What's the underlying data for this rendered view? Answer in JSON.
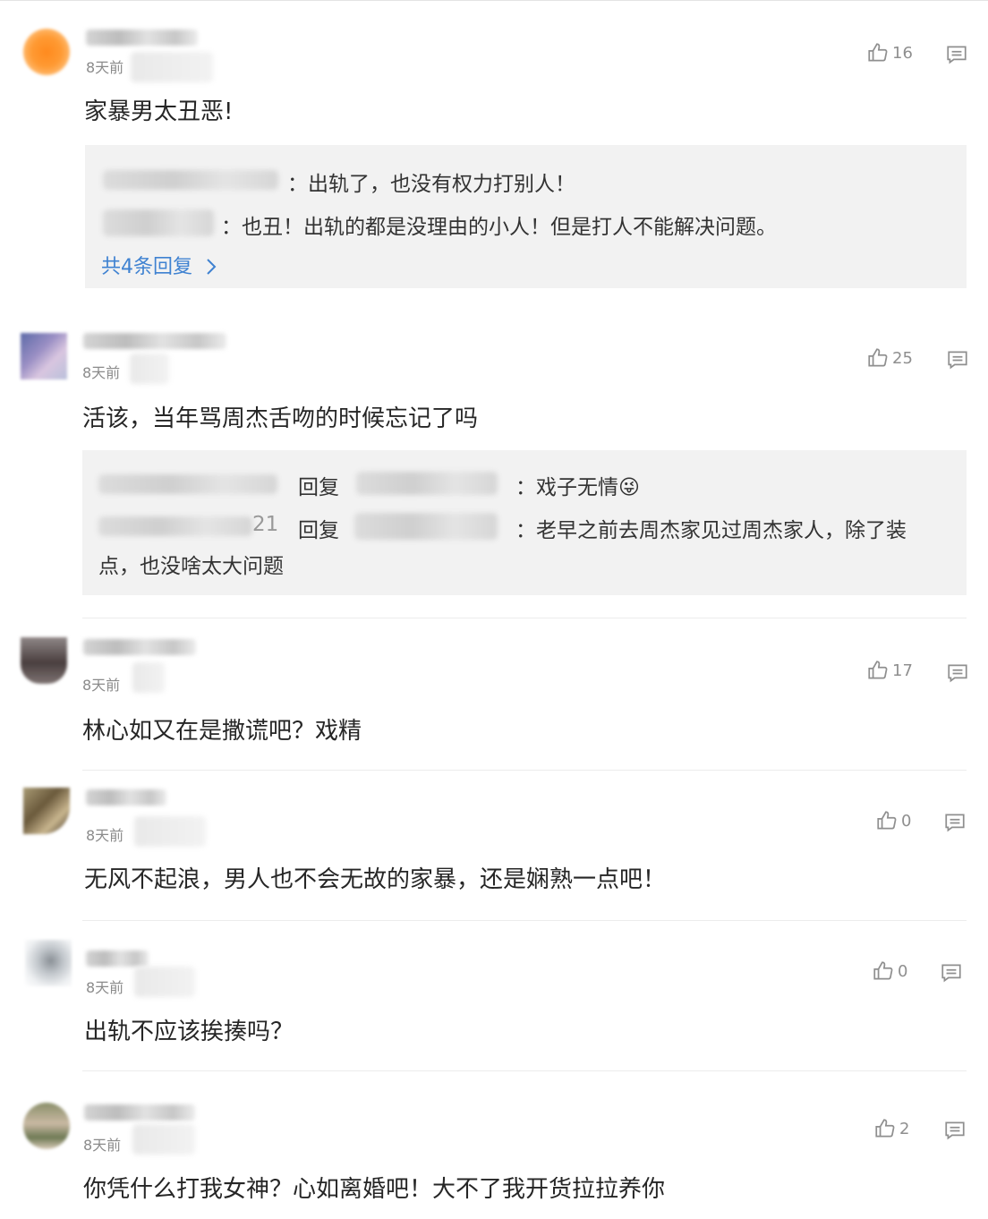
{
  "comments": [
    {
      "time": "8天前",
      "text": "家暴男太丑恶!",
      "likes": "16",
      "avatar_colors": [
        "#ff8a1e",
        "#ffb25c"
      ],
      "replies": [
        {
          "text": "：出轨了，也没有权力打别人！"
        },
        {
          "text": "：也丑！出轨的都是没理由的小人！但是打人不能解决问题。"
        }
      ],
      "more_replies": "共4条回复"
    },
    {
      "time": "8天前",
      "text": "活该，当年骂周杰舌吻的时候忘记了吗",
      "likes": "25",
      "avatar_colors": [
        "#6e72a6",
        "#c9c3de"
      ],
      "replies": [
        {
          "reply_word": "回复",
          "text": "：戏子无情😜"
        },
        {
          "partial": "21",
          "reply_word": "回复",
          "text": "：老早之前去周杰家见过周杰家人，除了装",
          "text_wrap": "点，也没啥太大问题"
        }
      ]
    },
    {
      "time": "8天前",
      "text": "林心如又在是撒谎吧？戏精",
      "likes": "17",
      "avatar_colors": [
        "#5a5050",
        "#a89d9a"
      ]
    },
    {
      "time": "8天前",
      "text": "无风不起浪，男人也不会无故的家暴，还是娴熟一点吧！",
      "likes": "0",
      "avatar_colors": [
        "#6b5a3c",
        "#b3a27d"
      ]
    },
    {
      "time": "8天前",
      "text": "出轨不应该挨揍吗？",
      "likes": "0",
      "avatar_colors": [
        "#9ea3a8",
        "#e6e8ea"
      ]
    },
    {
      "time": "8天前",
      "text": "你凭什么打我女神？心如离婚吧！大不了我开货拉拉养你",
      "likes": "2",
      "avatar_colors": [
        "#6f7a55",
        "#c8b7a0"
      ]
    }
  ]
}
